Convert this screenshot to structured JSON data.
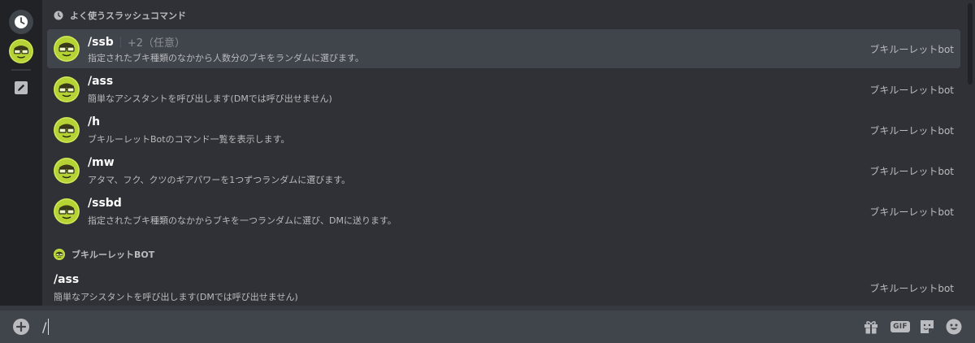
{
  "frequent_section": {
    "title": "よく使うスラッシュコマンド",
    "icon": "clock-icon"
  },
  "frequent_commands": [
    {
      "name": "/ssb",
      "option": "+2（任意）",
      "description": "指定されたブキ種類のなかから人数分のブキをランダムに選びます。",
      "owner": "ブキルーレットbot"
    },
    {
      "name": "/ass",
      "option": "",
      "description": "簡単なアシスタントを呼び出します(DMでは呼び出せません)",
      "owner": "ブキルーレットbot"
    },
    {
      "name": "/h",
      "option": "",
      "description": "ブキルーレットBotのコマンド一覧を表示します。",
      "owner": "ブキルーレットbot"
    },
    {
      "name": "/mw",
      "option": "",
      "description": "アタマ、フク、クツのギアパワーを1つずつランダムに選びます。",
      "owner": "ブキルーレットbot"
    },
    {
      "name": "/ssbd",
      "option": "",
      "description": "指定されたブキ種類のなかからブキを一つランダムに選び、DMに送ります。",
      "owner": "ブキルーレットbot"
    }
  ],
  "bot_section": {
    "title": "ブキルーレットBOT",
    "icon": "bot-avatar-icon"
  },
  "bot_commands": [
    {
      "name": "/ass",
      "description": "簡単なアシスタントを呼び出します(DMでは呼び出せません)",
      "owner": "ブキルーレットbot"
    }
  ],
  "composer": {
    "value": "/",
    "icons": [
      "plus-circle-icon",
      "gift-icon",
      "gif-icon",
      "sticker-icon",
      "emoji-icon"
    ],
    "gif_label": "GIF"
  },
  "colors": {
    "background": "#36393f",
    "popup": "#2f3136",
    "rail": "#202225",
    "selected_row": "#40444b",
    "avatar_green": "#b5d334"
  }
}
